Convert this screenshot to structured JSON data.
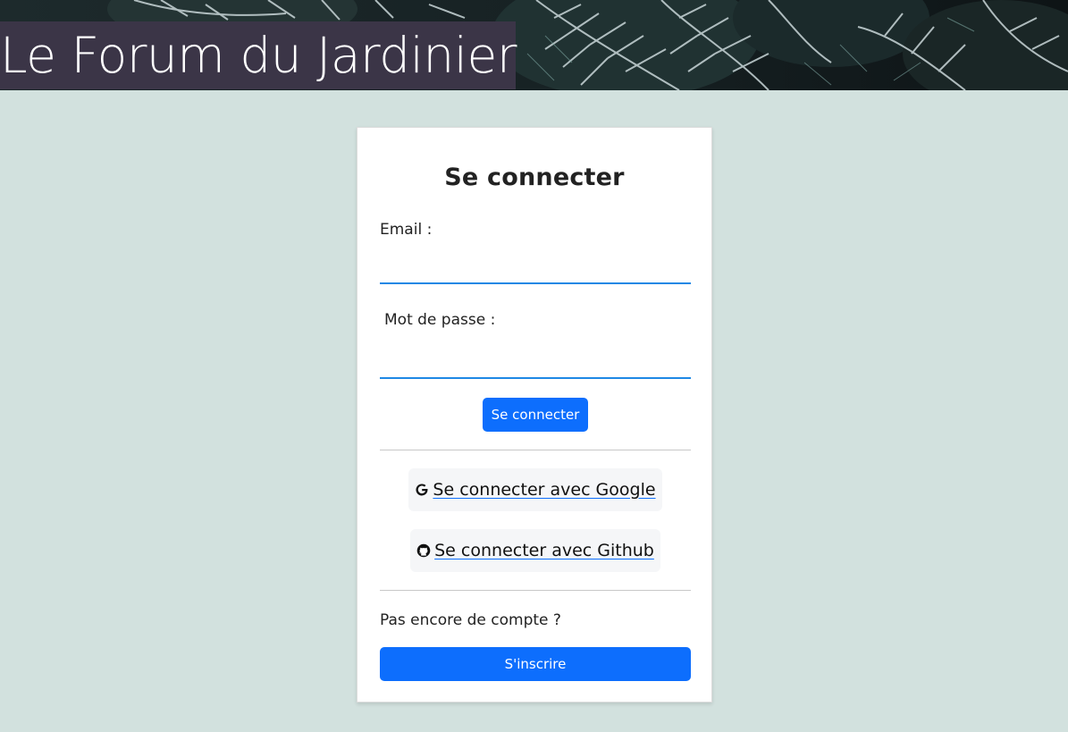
{
  "header": {
    "title": "Le Forum du Jardinier"
  },
  "login": {
    "title": "Se connecter",
    "email_label": "Email :",
    "email_value": "",
    "password_label": "Mot de passe :",
    "password_value": "",
    "submit_label": "Se connecter",
    "google_label": " Se connecter avec Google",
    "github_label": " Se connecter avec Github",
    "no_account_text": "Pas encore de compte ?",
    "signup_label": "S'inscrire"
  },
  "icons": {
    "google": "google-icon",
    "github": "github-icon"
  },
  "colors": {
    "background": "#d2e1de",
    "title_bg": "#3b3547",
    "primary": "#0d6efd",
    "input_underline": "#1e88e5"
  }
}
